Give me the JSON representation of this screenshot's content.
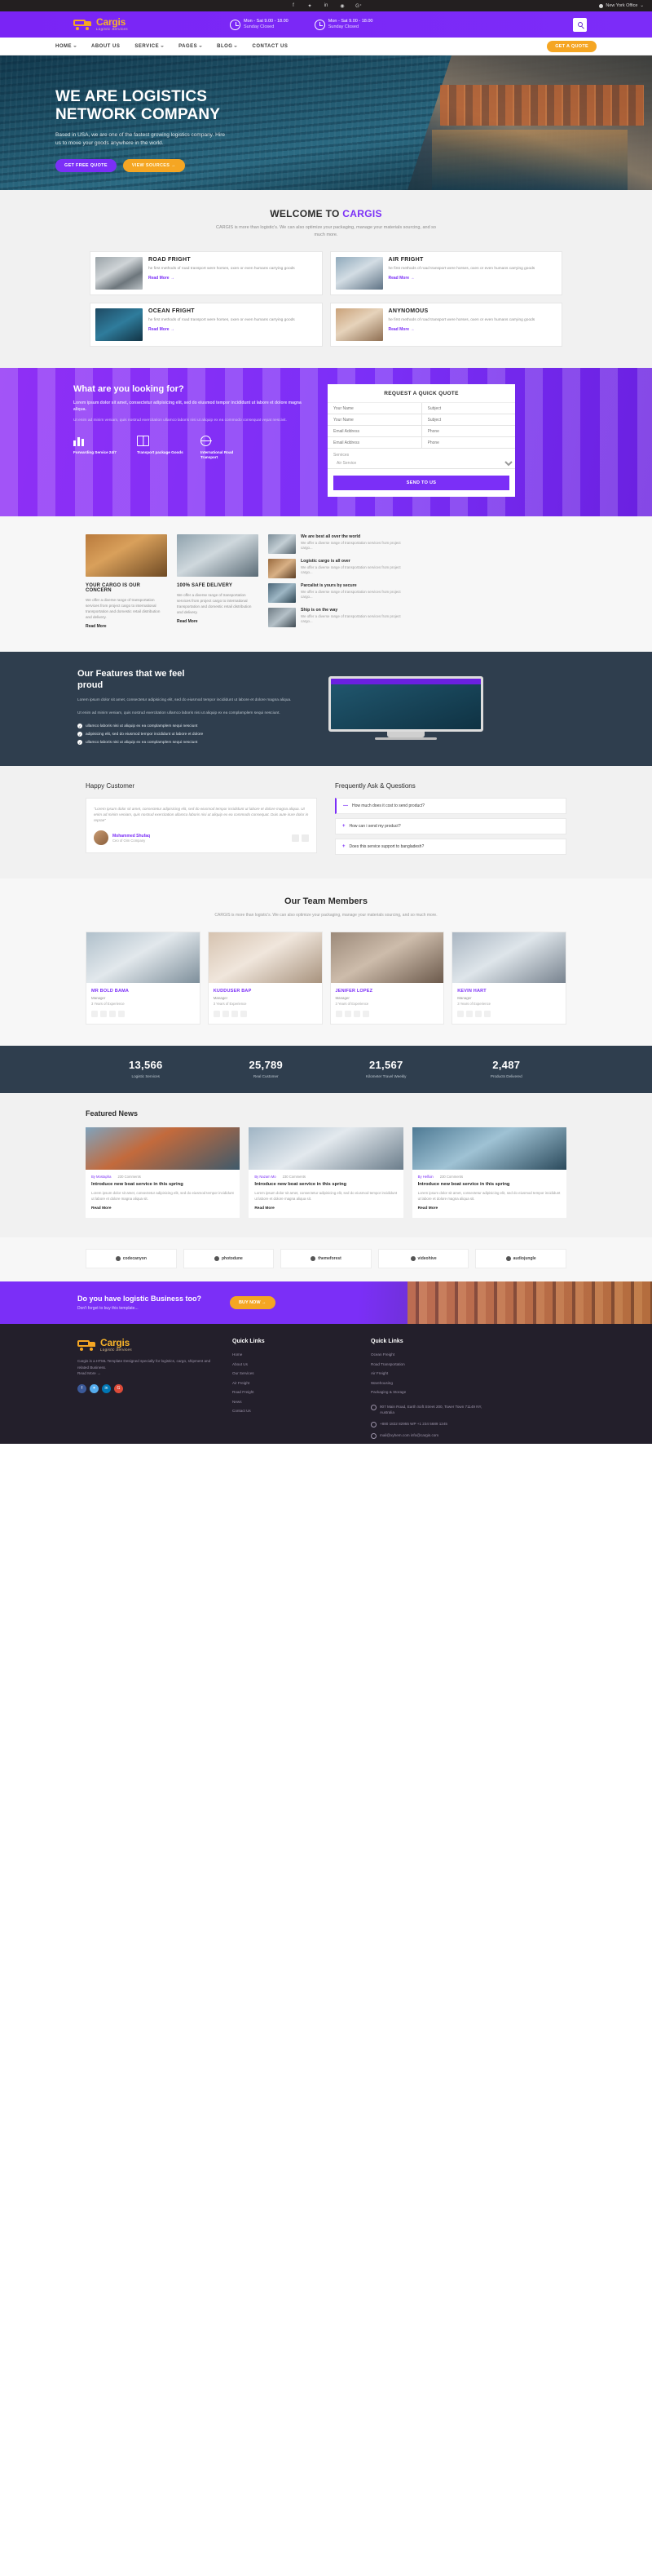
{
  "topbar": {
    "social": [
      {
        "name": "facebook-icon",
        "glyph": "f"
      },
      {
        "name": "twitter-icon",
        "glyph": "🐦"
      },
      {
        "name": "linkedin-icon",
        "glyph": "in"
      },
      {
        "name": "dribbble-icon",
        "glyph": "◉"
      },
      {
        "name": "google-plus-icon",
        "glyph": "G+"
      }
    ],
    "office": "New York Office"
  },
  "header": {
    "logo_title": "Cargis",
    "logo_sub": "Logistic Services",
    "hours": [
      {
        "line1": "Mon - Sat 9.00 - 18.00",
        "line2": "Sunday Closed"
      },
      {
        "line1": "Mon - Sat 9.00 - 18.00",
        "line2": "Sunday Closed"
      }
    ]
  },
  "nav": {
    "items": [
      {
        "label": "HOME",
        "caret": true
      },
      {
        "label": "ABOUT US",
        "caret": false
      },
      {
        "label": "SERVICE",
        "caret": true
      },
      {
        "label": "PAGES",
        "caret": true
      },
      {
        "label": "BLOG",
        "caret": true
      },
      {
        "label": "CONTACT US",
        "caret": false
      }
    ],
    "cta": "GET A QUOTE"
  },
  "hero": {
    "title_line1": "WE ARE LOGISTICS",
    "title_line2": "NETWORK COMPANY",
    "desc": "Based in USA, we are one of the fastest growing logistics company. Hire us to move your goods anywhere in the world.",
    "btn_primary": "GET FREE QUOTE",
    "btn_secondary": "VIEW SOURCES →"
  },
  "welcome": {
    "title_plain": "WELCOME TO ",
    "title_accent": "CARGIS",
    "sub": "CARGIS is more than logistic's. We can also optimize your packaging, manage your materials sourcing, and so much more.",
    "services": [
      {
        "title": "ROAD FRIGHT",
        "desc": "he first methods of road transport were horses, oxen or even humans carrying goods",
        "link": "Read More  →",
        "img": "img-road"
      },
      {
        "title": "AIR FRIGHT",
        "desc": "he first methods of road transport were horses, oxen or even humans carrying goods",
        "link": "Read More  →",
        "img": "img-air"
      },
      {
        "title": "OCEAN FRIGHT",
        "desc": "he first methods of road transport were horses, oxen or even humans carrying goods",
        "link": "Read More  →",
        "img": "img-ocean"
      },
      {
        "title": "ANYNOMOUS",
        "desc": "he first methods of road transport were horses, oxen or even humans carrying goods",
        "link": "Read More  →",
        "img": "img-anon"
      }
    ]
  },
  "quote": {
    "heading": "What are you looking for?",
    "desc1": "Lorem ipsum dolor sit amet, consectetur adipisicing elit, sed do eiusmod tempor incididunt ut labore et dolore magna aliqua.",
    "desc2": "Ut enim ad minim veniam, quis nostrud exercitation ullamco laboris nisi ut aliquip ex ea commodo consequat vepat nescivit.",
    "features": [
      {
        "title": "Forwarding Service 24/7",
        "icon": "bars-icon"
      },
      {
        "title": "Transport package Goods",
        "icon": "box-icon"
      },
      {
        "title": "International Road Transport",
        "icon": "globe-icon"
      }
    ],
    "form_title": "REQUEST A QUICK QUOTE",
    "fields": [
      {
        "placeholder": "Your Name"
      },
      {
        "placeholder": "Subject"
      },
      {
        "placeholder": "Your Name"
      },
      {
        "placeholder": "Subject"
      },
      {
        "placeholder": "Email Address"
      },
      {
        "placeholder": "Phone"
      },
      {
        "placeholder": "Email Address"
      },
      {
        "placeholder": "Phone"
      }
    ],
    "select_label": "Services",
    "select_value": "Air Service",
    "submit": "SEND TO US"
  },
  "cargo": {
    "left": {
      "img": "cg-a",
      "title": "YOUR CARGO IS OUR CONCERN",
      "desc": "We offer a diverse range of transportation services from project cargo to international transportation and domestic retail distribution and delivery.",
      "link": "Read More"
    },
    "mid": {
      "img": "cg-b",
      "title": "100% SAFE DELIVERY",
      "desc": "We offer a diverse range of transportation services from project cargo to international transportation and domestic retail distribution and delivery.",
      "link": "Read More"
    },
    "list": [
      {
        "title": "We are best all over the world",
        "desc": "We offer a diverse range of transportation services from project cargo...",
        "thumb": "th1"
      },
      {
        "title": "Logistic cargo is all over",
        "desc": "We offer a diverse range of transportation services from project cargo...",
        "thumb": "th2"
      },
      {
        "title": "Parcalist is yours by secure",
        "desc": "We offer a diverse range of transportation services from project cargo...",
        "thumb": "th3"
      },
      {
        "title": "Ship is on the way",
        "desc": "We offer a diverse range of transportation services from project cargo...",
        "thumb": "th4"
      }
    ]
  },
  "features": {
    "title_l1": "Our Features that we feel",
    "title_l2": "proud",
    "p1": "Lorem ipsum dolor sit amet, consectetur adipisicing elit, sed do eiusmod tempor incididunt ut labore et dolore magna aliqua.",
    "p2": "Ut enim ad minim veniam, quis nostrud exercitation ullamco laboris nisi ut aliquip ex ea complamplem sequi nesciunt.",
    "bullets": [
      "ullamco laboris nisi ut aliquip ex ea complamplem sequi nesciunt",
      "adipisicing elit, sed do eiusmod tempor incididunt ut labore et dolore",
      "ullamco laboris nisi ut aliquip ex ea complamplem sequi nesciunt"
    ]
  },
  "happy": {
    "title": "Happy Customer",
    "quote": "\"Lorem ipsum dolor sit amet, consectetur adipisicing elit, sed do eiusmod tempor incididunt ut labore et dolore magna aliqua. Ut enim ad minim veniam, quis nostrud exercitation ullamco laboris nisi ut aliquip ex ea commodo consequat. Duis aute irure dolor in reprae\"",
    "name": "Mohammed Shufaq",
    "role": "Ceo of Oim Company"
  },
  "faq": {
    "title": "Frequently Ask & Questions",
    "items": [
      {
        "icon": "—",
        "label": "How much does it cost to send product?",
        "active": true
      },
      {
        "icon": "+",
        "label": "How can i send my product?",
        "active": false
      },
      {
        "icon": "+",
        "label": "Does this service support to bangladesh?",
        "active": false
      }
    ]
  },
  "team": {
    "title": "Our Team Members",
    "sub": "CARGIS is more than logistic's. We can also optimize your packaging, manage your materials sourcing, and so much more.",
    "members": [
      {
        "name": "MR BOLD BAMA",
        "role": "Manager",
        "exp": "3 Years of Experience",
        "img": "tm1"
      },
      {
        "name": "KUDDUSER BAP",
        "role": "Manager",
        "exp": "3 Years of Experience",
        "img": "tm2"
      },
      {
        "name": "JENIFER LOPEZ",
        "role": "Manager",
        "exp": "3 Years of Experience",
        "img": "tm3"
      },
      {
        "name": "KEVIN HART",
        "role": "Manager",
        "exp": "3 Years of Experience",
        "img": "tm4"
      }
    ]
  },
  "stats": [
    {
      "number": "13,566",
      "label": "Logistic Services"
    },
    {
      "number": "25,789",
      "label": "Real Customer"
    },
    {
      "number": "21,567",
      "label": "Kilometer Travel Weekly"
    },
    {
      "number": "2,487",
      "label": "Products Delivered"
    }
  ],
  "news": {
    "title": "Featured News",
    "items": [
      {
        "author": "By Mostapha",
        "comments": "230 Comments",
        "title": "Introduce new boat service in this spring",
        "desc": "Lorem ipsum dolor sit amet, consectetur adipisicing elit, sed do eiusmod tempor incididunt ut labore et dolore magna aliqua sit.",
        "link": "Read More",
        "img": "nw1"
      },
      {
        "author": "By Nazam Mo",
        "comments": "230 Comments",
        "title": "Introduce new boat service in this spring",
        "desc": "Lorem ipsum dolor sit amet, consectetur adipisicing elit, sed do eiusmod tempor incididunt ut labore et dolore magna aliqua sit.",
        "link": "Read More",
        "img": "nw2"
      },
      {
        "author": "By Helfuin",
        "comments": "230 Comments",
        "title": "Introduce new boat service in this spring",
        "desc": "Lorem ipsum dolor sit amet, consectetur adipisicing elit, sed do eiusmod tempor incididunt ut labore et dolore magna aliqua sit.",
        "link": "Read More",
        "img": "nw3"
      }
    ]
  },
  "clients": [
    {
      "name": "codecanyon"
    },
    {
      "name": "photodune"
    },
    {
      "name": "themeforest"
    },
    {
      "name": "videohive"
    },
    {
      "name": "audiojungle"
    }
  ],
  "cta": {
    "title": "Do you have logistic Business too?",
    "sub": "Don't forget to buy this template...",
    "button": "BUY NOW →"
  },
  "footer": {
    "logo_title": "Cargis",
    "logo_sub": "Logistic Services",
    "about": "Cargis is a HTML Template Designed specially for logistics, cargo, shipment and related Business.",
    "about_link": "Read More →",
    "quick_links_title": "Quick Links",
    "quick_links": [
      "Home",
      "About Us",
      "Our Services",
      "Air Freight",
      "Road Freight",
      "News",
      "Contact Us"
    ],
    "quick_links2_title": "Quick Links",
    "quick_links2": [
      "Ocean Freight",
      "Road Transportation",
      "Air Freight",
      "Warehousing",
      "Packaging & Storage"
    ],
    "contact": [
      {
        "icon": "location-icon",
        "text": "907 Main Road, Earth Soft Street 200, Tower Town 71149 NY, Australia"
      },
      {
        "icon": "phone-icon",
        "text": "+880 1822 82955 WP\n+1 234 5689 1245"
      },
      {
        "icon": "mail-icon",
        "text": "mail@xyhem.com\ninfo@cargis.com"
      }
    ]
  }
}
